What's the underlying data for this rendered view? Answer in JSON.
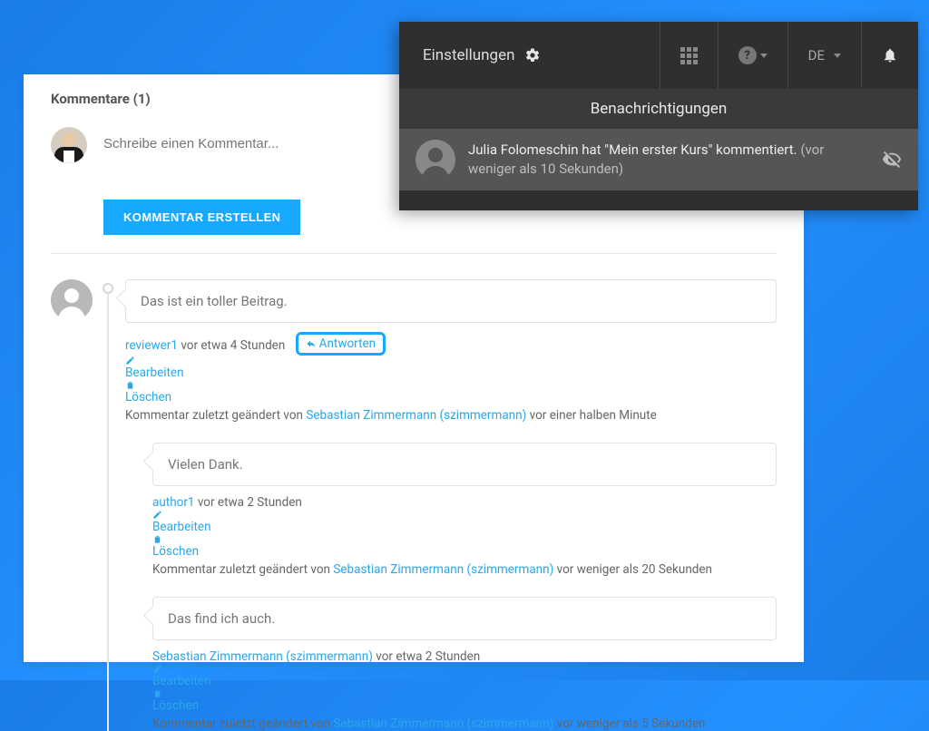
{
  "card": {
    "title": "Kommentare (1)",
    "compose_placeholder": "Schreibe einen Kommentar...",
    "submit_label": "KOMMENTAR ERSTELLEN"
  },
  "actions": {
    "reply": "Antworten",
    "edit": "Bearbeiten",
    "delete": "Löschen"
  },
  "labels": {
    "last_edited_prefix": "Kommentar zuletzt geändert von "
  },
  "comments": [
    {
      "body": "Das ist ein toller Beitrag.",
      "author": "reviewer1",
      "time": "vor etwa 4 Stunden",
      "edited_by": "Sebastian Zimmermann (szimmermann)",
      "edited_time": "vor einer halben Minute",
      "show_reply_highlight": true,
      "replies": [
        {
          "body": "Vielen Dank.",
          "author": "author1",
          "time": "vor etwa 2 Stunden",
          "edited_by": "Sebastian Zimmermann (szimmermann)",
          "edited_time": "vor weniger als 20 Sekunden"
        },
        {
          "body": "Das find ich auch.",
          "author": "Sebastian Zimmermann (szimmermann)",
          "time": "vor etwa 2 Stunden",
          "edited_by": "Sebastian Zimmermann (szimmermann)",
          "edited_time": "vor weniger als 5 Sekunden"
        }
      ]
    }
  ],
  "topbar": {
    "settings": "Einstellungen",
    "lang": "DE",
    "notifications_title": "Benachrichtigungen",
    "notification": {
      "actor": "Julia Folomeschin",
      "text_mid": " hat \"Mein erster Kurs\" kommentiert. ",
      "time": "(vor weniger als 10 Sekunden)"
    }
  }
}
